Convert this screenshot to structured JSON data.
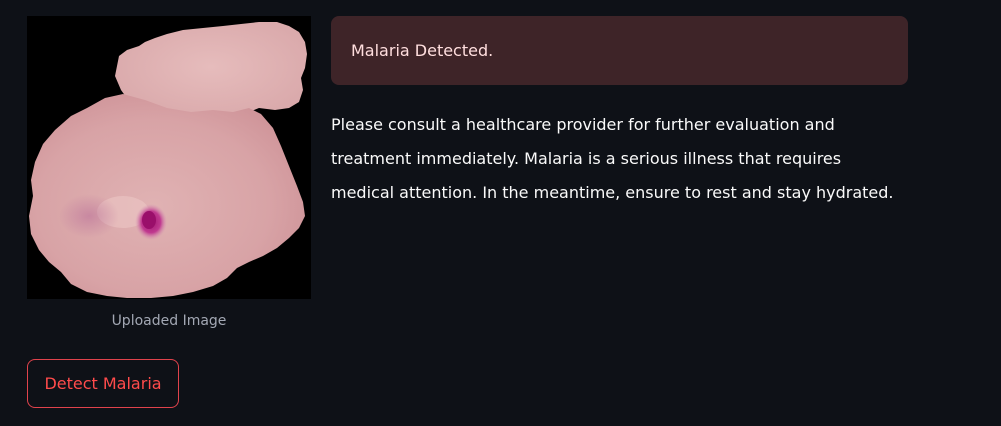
{
  "uploaded_image": {
    "caption": "Uploaded Image",
    "subject": "blood-cell-micrograph"
  },
  "result": {
    "alert_text": "Malaria Detected.",
    "advice_text": "Please consult a healthcare provider for further evaluation and treatment immediately. Malaria is a serious illness that requires medical attention. In the meantime, ensure to rest and stay hydrated."
  },
  "actions": {
    "detect_label": "Detect Malaria"
  },
  "colors": {
    "background": "#0e1117",
    "alert_background": "#3e2428",
    "alert_text": "#ffdede",
    "button_accent": "#ff4b4b",
    "cell_fill": "#d9a4a6",
    "parasite_stain": "#b3207f"
  }
}
